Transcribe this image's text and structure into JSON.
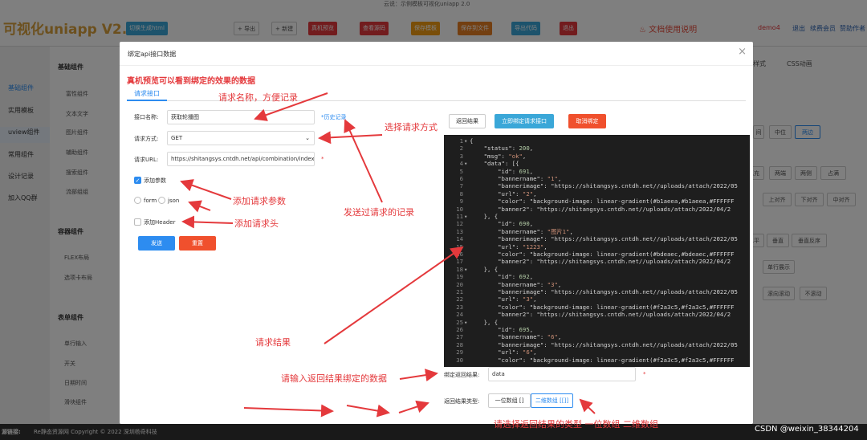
{
  "app": {
    "logo": "可视化uniapp V2.0",
    "subtitle": "云说：示例模板可视化uniapp 2.0",
    "toolbar": [
      {
        "label": "切换生成html",
        "color": "#3aa7d8"
      },
      {
        "label": "+ 导出",
        "color": "white"
      },
      {
        "label": "+ 新建",
        "color": "white"
      },
      {
        "label": "真机预览",
        "color": "#e4393c"
      },
      {
        "label": "查看源码",
        "color": "#e4393c"
      },
      {
        "label": "保存模板",
        "color": "#f39c12"
      },
      {
        "label": "保存到文件",
        "color": "#e67e22"
      },
      {
        "label": "导出代码",
        "color": "#3aa7d8"
      },
      {
        "label": "退出",
        "color": "#e4393c"
      }
    ],
    "docs_label": "文档使用说明",
    "user": {
      "name": "demo4",
      "logout": "退出",
      "vip": "续费会员",
      "sponsor": "赞助作者"
    },
    "leftnav": [
      "基础组件",
      "实用模板",
      "uview组件",
      "常用组件",
      "设计记录",
      "加入QQ群"
    ],
    "groups": [
      {
        "title": "基础组件",
        "items": [
          "富性组件",
          "图文",
          "文本文字",
          "头像",
          "图片组件",
          "标签",
          "辅助组件",
          "标签",
          "搜索组件",
          "顶部",
          "流部组组",
          "通知"
        ]
      },
      {
        "title": "容器组件",
        "items": [
          "FLEX布局",
          "表单",
          "选项卡布局"
        ]
      },
      {
        "title": "表单组件",
        "items": [
          "单行输入",
          "多行",
          "开关",
          "下拉选",
          "日期时间",
          "图片",
          "滑块组件",
          "步组"
        ]
      }
    ],
    "right_panel": {
      "tabs": [
        "样式",
        "CSS动画"
      ],
      "rows": [
        [
          "间",
          "中位",
          "两边"
        ],
        [
          "填充",
          "两端",
          "两侧",
          "占满"
        ],
        [
          "上对齐",
          "下对齐",
          "中对齐"
        ],
        [
          "水平",
          "垂直",
          "垂直反序"
        ],
        [
          "单行展示"
        ],
        [
          "滚向滚动",
          "不滚动"
        ]
      ]
    },
    "footer": {
      "label": "源链接:",
      "copyright": "Re静态资源网  Copyright © 2022 深圳杨奇科技"
    }
  },
  "modal": {
    "title": "绑定api接口数据",
    "close": "×",
    "tip": "真机预览可以看到绑定的效果的数据",
    "tab": "请求接口",
    "api_name_label": "接口名称:",
    "api_name_value": "获取轮播图",
    "history_link": "*历史记录",
    "method_label": "请求方式:",
    "method_value": "GET",
    "url_label": "请求URL:",
    "url_value": "https://shitangsys.cntdh.net/api/combination/indexbanner",
    "required_mark": "*",
    "add_params_label": "添加参数",
    "radio_form": "form",
    "radio_json": "json",
    "add_header_label": "添加Header",
    "send_button": "发送",
    "reset_button": "重置",
    "return_button": "返回结果",
    "bind_button": "立即绑定请求接口",
    "unbind_button": "取消绑定",
    "bind_result_label": "绑定返回结果:",
    "bind_result_value": "data",
    "result_type_label": "返回结果类型:",
    "type_1d": "一位数组 []",
    "type_2d": "二维数组 [[]]",
    "code_lines": [
      {
        "n": "1",
        "f": "▾",
        "t": "{"
      },
      {
        "n": "2",
        "f": "",
        "t": "    \"status\": 200,"
      },
      {
        "n": "3",
        "f": "",
        "t": "    \"msg\": \"ok\","
      },
      {
        "n": "4",
        "f": "▾",
        "t": "    \"data\": [{"
      },
      {
        "n": "5",
        "f": "",
        "t": "        \"id\": 691,"
      },
      {
        "n": "6",
        "f": "",
        "t": "        \"bannername\": \"1\","
      },
      {
        "n": "7",
        "f": "",
        "t": "        \"bannerimage\": \"https://shitangsys.cntdh.net//uploads/attach/2022/05"
      },
      {
        "n": "8",
        "f": "",
        "t": "        \"url\": \"2\","
      },
      {
        "n": "9",
        "f": "",
        "t": "        \"color\": \"background-image: linear-gradient(#b1aeea,#b1aeea,#FFFFFF"
      },
      {
        "n": "10",
        "f": "",
        "t": "        \"banner2\": \"https://shitangsys.cntdh.net//uploads/attach/2022/04/2"
      },
      {
        "n": "11",
        "f": "▾",
        "t": "    }, {"
      },
      {
        "n": "12",
        "f": "",
        "t": "        \"id\": 690,"
      },
      {
        "n": "13",
        "f": "",
        "t": "        \"bannername\": \"图片1\","
      },
      {
        "n": "14",
        "f": "",
        "t": "        \"bannerimage\": \"https://shitangsys.cntdh.net//uploads/attach/2022/05"
      },
      {
        "n": "15",
        "f": "",
        "t": "        \"url\": \"1223\","
      },
      {
        "n": "16",
        "f": "",
        "t": "        \"color\": \"background-image: linear-gradient(#bdeaec,#bdeaec,#FFFFFF"
      },
      {
        "n": "17",
        "f": "",
        "t": "        \"banner2\": \"https://shitangsys.cntdh.net//uploads/attach/2022/04/2"
      },
      {
        "n": "18",
        "f": "▾",
        "t": "    }, {"
      },
      {
        "n": "19",
        "f": "",
        "t": "        \"id\": 692,"
      },
      {
        "n": "20",
        "f": "",
        "t": "        \"bannername\": \"3\","
      },
      {
        "n": "21",
        "f": "",
        "t": "        \"bannerimage\": \"https://shitangsys.cntdh.net//uploads/attach/2022/05"
      },
      {
        "n": "22",
        "f": "",
        "t": "        \"url\": \"3\","
      },
      {
        "n": "23",
        "f": "",
        "t": "        \"color\": \"background-image: linear-gradient(#f2a3c5,#f2a3c5,#FFFFFF"
      },
      {
        "n": "24",
        "f": "",
        "t": "        \"banner2\": \"https://shitangsys.cntdh.net//uploads/attach/2022/04/2"
      },
      {
        "n": "25",
        "f": "▾",
        "t": "    }, {"
      },
      {
        "n": "26",
        "f": "",
        "t": "        \"id\": 695,"
      },
      {
        "n": "27",
        "f": "",
        "t": "        \"bannername\": \"6\","
      },
      {
        "n": "28",
        "f": "",
        "t": "        \"bannerimage\": \"https://shitangsys.cntdh.net//uploads/attach/2022/05"
      },
      {
        "n": "29",
        "f": "",
        "t": "        \"url\": \"6\","
      },
      {
        "n": "30",
        "f": "",
        "t": "        \"color\": \"background-image: linear-gradient(#f2a3c5,#f2a3c5,#FFFFFF"
      }
    ]
  },
  "annotations": {
    "name_tip": "请求名称，方便记录",
    "method_tip": "选择请求方式",
    "params_tip": "添加请求参数",
    "header_tip": "添加请求头",
    "history_tip": "发送过请求的记录",
    "result_tip": "请求结果",
    "bind_tip": "请输入返回结果绑定的数据",
    "type_tip": "请选择返回结果的类型  一位数组  二维数组"
  },
  "watermark": "CSDN @weixin_38344204",
  "colors": {
    "primary": "#2d8cf0",
    "danger": "#e4393c",
    "annotation": "#e4393c",
    "code_bg": "#1e1e1e"
  }
}
